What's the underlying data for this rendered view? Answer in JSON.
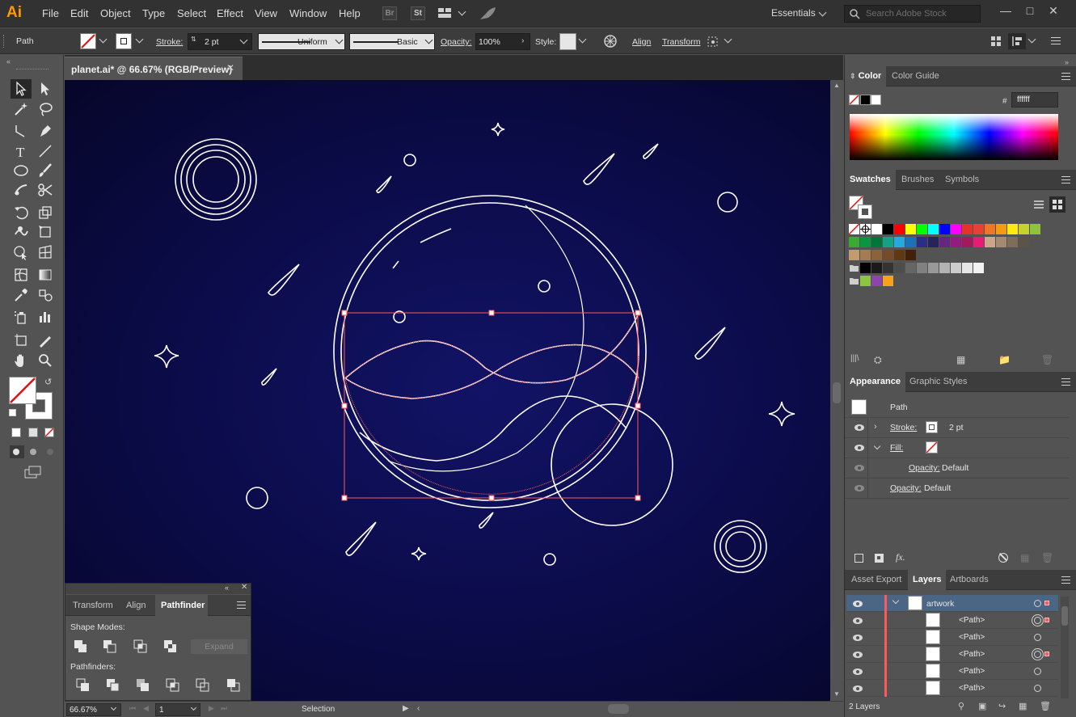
{
  "app": {
    "logo": "Ai",
    "menu": [
      "File",
      "Edit",
      "Object",
      "Type",
      "Select",
      "Effect",
      "View",
      "Window",
      "Help"
    ],
    "bridge": "Br",
    "stock": "St",
    "workspace": "Essentials",
    "search_placeholder": "Search Adobe Stock"
  },
  "control": {
    "selection_type": "Path",
    "stroke_label": "Stroke:",
    "stroke_weight": "2 pt",
    "profile": "Uniform",
    "brush": "Basic",
    "opacity_label": "Opacity:",
    "opacity_value": "100%",
    "style_label": "Style:",
    "align_label": "Align",
    "transform_label": "Transform"
  },
  "document": {
    "tab_title": "planet.ai* @ 66.67% (RGB/Preview)",
    "canvas_bg": "#0d0e55",
    "artwork_stroke": "#ffffff",
    "selection_color": "#ff5a5a"
  },
  "status": {
    "zoom": "66.67%",
    "artboard": "1",
    "tool": "Selection"
  },
  "pathfinder": {
    "tabs": [
      "Transform",
      "Align",
      "Pathfinder"
    ],
    "active_tab": "Pathfinder",
    "shape_modes_label": "Shape Modes:",
    "expand_label": "Expand",
    "pathfinders_label": "Pathfinders:"
  },
  "color_panel": {
    "tabs": [
      "Color",
      "Color Guide"
    ],
    "hex_symbol": "#",
    "hex_value": "ffffff"
  },
  "swatches_panel": {
    "tabs": [
      "Swatches",
      "Brushes",
      "Symbols"
    ],
    "row1": [
      "#ffffff",
      "#000000",
      "#ff0000",
      "#ffff00",
      "#00ff00",
      "#00ffff",
      "#0000ff",
      "#ff00ff",
      "#e6332a",
      "#e84133",
      "#ee7625",
      "#f39c12",
      "#fcea10",
      "#c6d32d",
      "#8fc23f"
    ],
    "row2": [
      "#3aaa35",
      "#0a9641",
      "#00753a",
      "#16a085",
      "#25a9e0",
      "#1d71b8",
      "#2d2e83",
      "#29235c",
      "#662483",
      "#951b81",
      "#a3195b",
      "#e71d73",
      "#cba68a",
      "#a48a70",
      "#7e6d5c",
      "#5d5449"
    ],
    "row3": [
      "#c49a6c",
      "#a57b52",
      "#8d6238",
      "#754c29",
      "#603913",
      "#42210b"
    ],
    "row4": [
      "#000000",
      "#1a1a1a",
      "#333333",
      "#4d4d4d",
      "#666666",
      "#808080",
      "#999999",
      "#b3b3b3",
      "#cccccc",
      "#e6e6e6",
      "#f2f2f2"
    ],
    "row5": [
      "#8cc63f",
      "#8e44ad",
      "#f7a21b"
    ]
  },
  "appearance_panel": {
    "tabs": [
      "Appearance",
      "Graphic Styles"
    ],
    "header": "Path",
    "stroke_label": "Stroke:",
    "stroke_value": "2 pt",
    "fill_label": "Fill:",
    "opacity_label": "Opacity:",
    "opacity_fill_value": "Default",
    "opacity_value": "Default"
  },
  "layers_panel": {
    "tabs": [
      "Asset Export",
      "Layers",
      "Artboards"
    ],
    "layer_name": "artwork",
    "rows": [
      "<Path>",
      "<Path>",
      "<Path>",
      "<Path>",
      "<Path>"
    ],
    "footer": "2 Layers"
  }
}
